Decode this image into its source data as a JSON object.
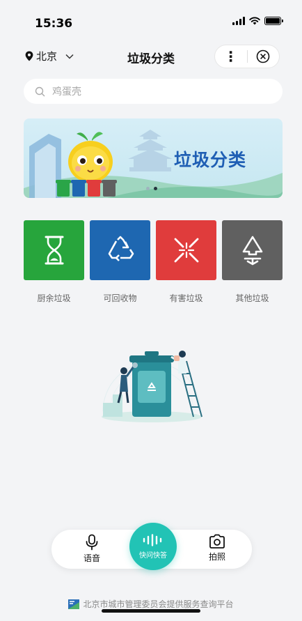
{
  "status": {
    "time": "15:36"
  },
  "nav": {
    "city": "北京",
    "title": "垃圾分类"
  },
  "search": {
    "placeholder": "鸡蛋壳"
  },
  "banner": {
    "title": "垃圾分类",
    "slide_count": 2,
    "active_slide": 2
  },
  "categories": [
    {
      "label": "厨余垃圾",
      "color": "#27a53c",
      "icon": "hourglass-icon"
    },
    {
      "label": "可回收物",
      "color": "#1e67b1",
      "icon": "recycle-icon"
    },
    {
      "label": "有害垃圾",
      "color": "#e03c3c",
      "icon": "hazard-icon"
    },
    {
      "label": "其他垃圾",
      "color": "#606060",
      "icon": "other-waste-icon"
    }
  ],
  "voice_bar": {
    "voice_label": "语音",
    "quick_label": "快问快答",
    "photo_label": "拍照"
  },
  "footer": {
    "text": "北京市城市管理委员会提供服务查询平台"
  },
  "colors": {
    "accent": "#22c3b5",
    "banner_title": "#1f5fb4"
  }
}
